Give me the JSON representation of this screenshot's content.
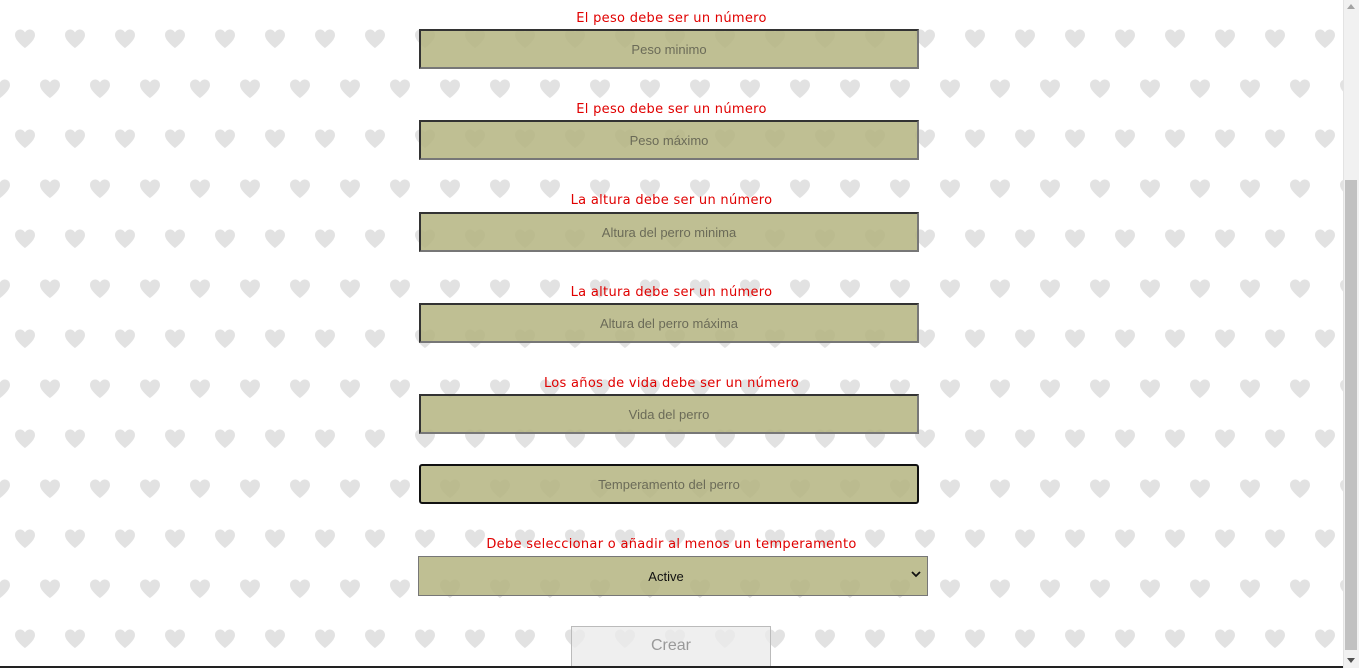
{
  "form": {
    "peso_min": {
      "error": "El peso debe ser un número",
      "placeholder": "Peso minimo"
    },
    "peso_max": {
      "error": "El peso debe ser un número",
      "placeholder": "Peso máximo"
    },
    "altura_min": {
      "error": "La altura debe ser un número",
      "placeholder": "Altura del perro minima"
    },
    "altura_max": {
      "error": "La altura debe ser un número",
      "placeholder": "Altura del perro máxima"
    },
    "vida": {
      "error": "Los años de vida debe ser un número",
      "placeholder": "Vida del perro"
    },
    "temperamento": {
      "placeholder": "Temperamento del perro"
    },
    "temperament_select": {
      "error": "Debe seleccionar o añadir al menos un temperamento",
      "selected": "Active"
    },
    "submit_label": "Crear"
  },
  "colors": {
    "error": "#e00000",
    "field_bg": "#bdbd90",
    "heart": "#e2e2e2"
  },
  "icons": {
    "background": "heart-pattern",
    "select": "chevron-down-icon"
  }
}
